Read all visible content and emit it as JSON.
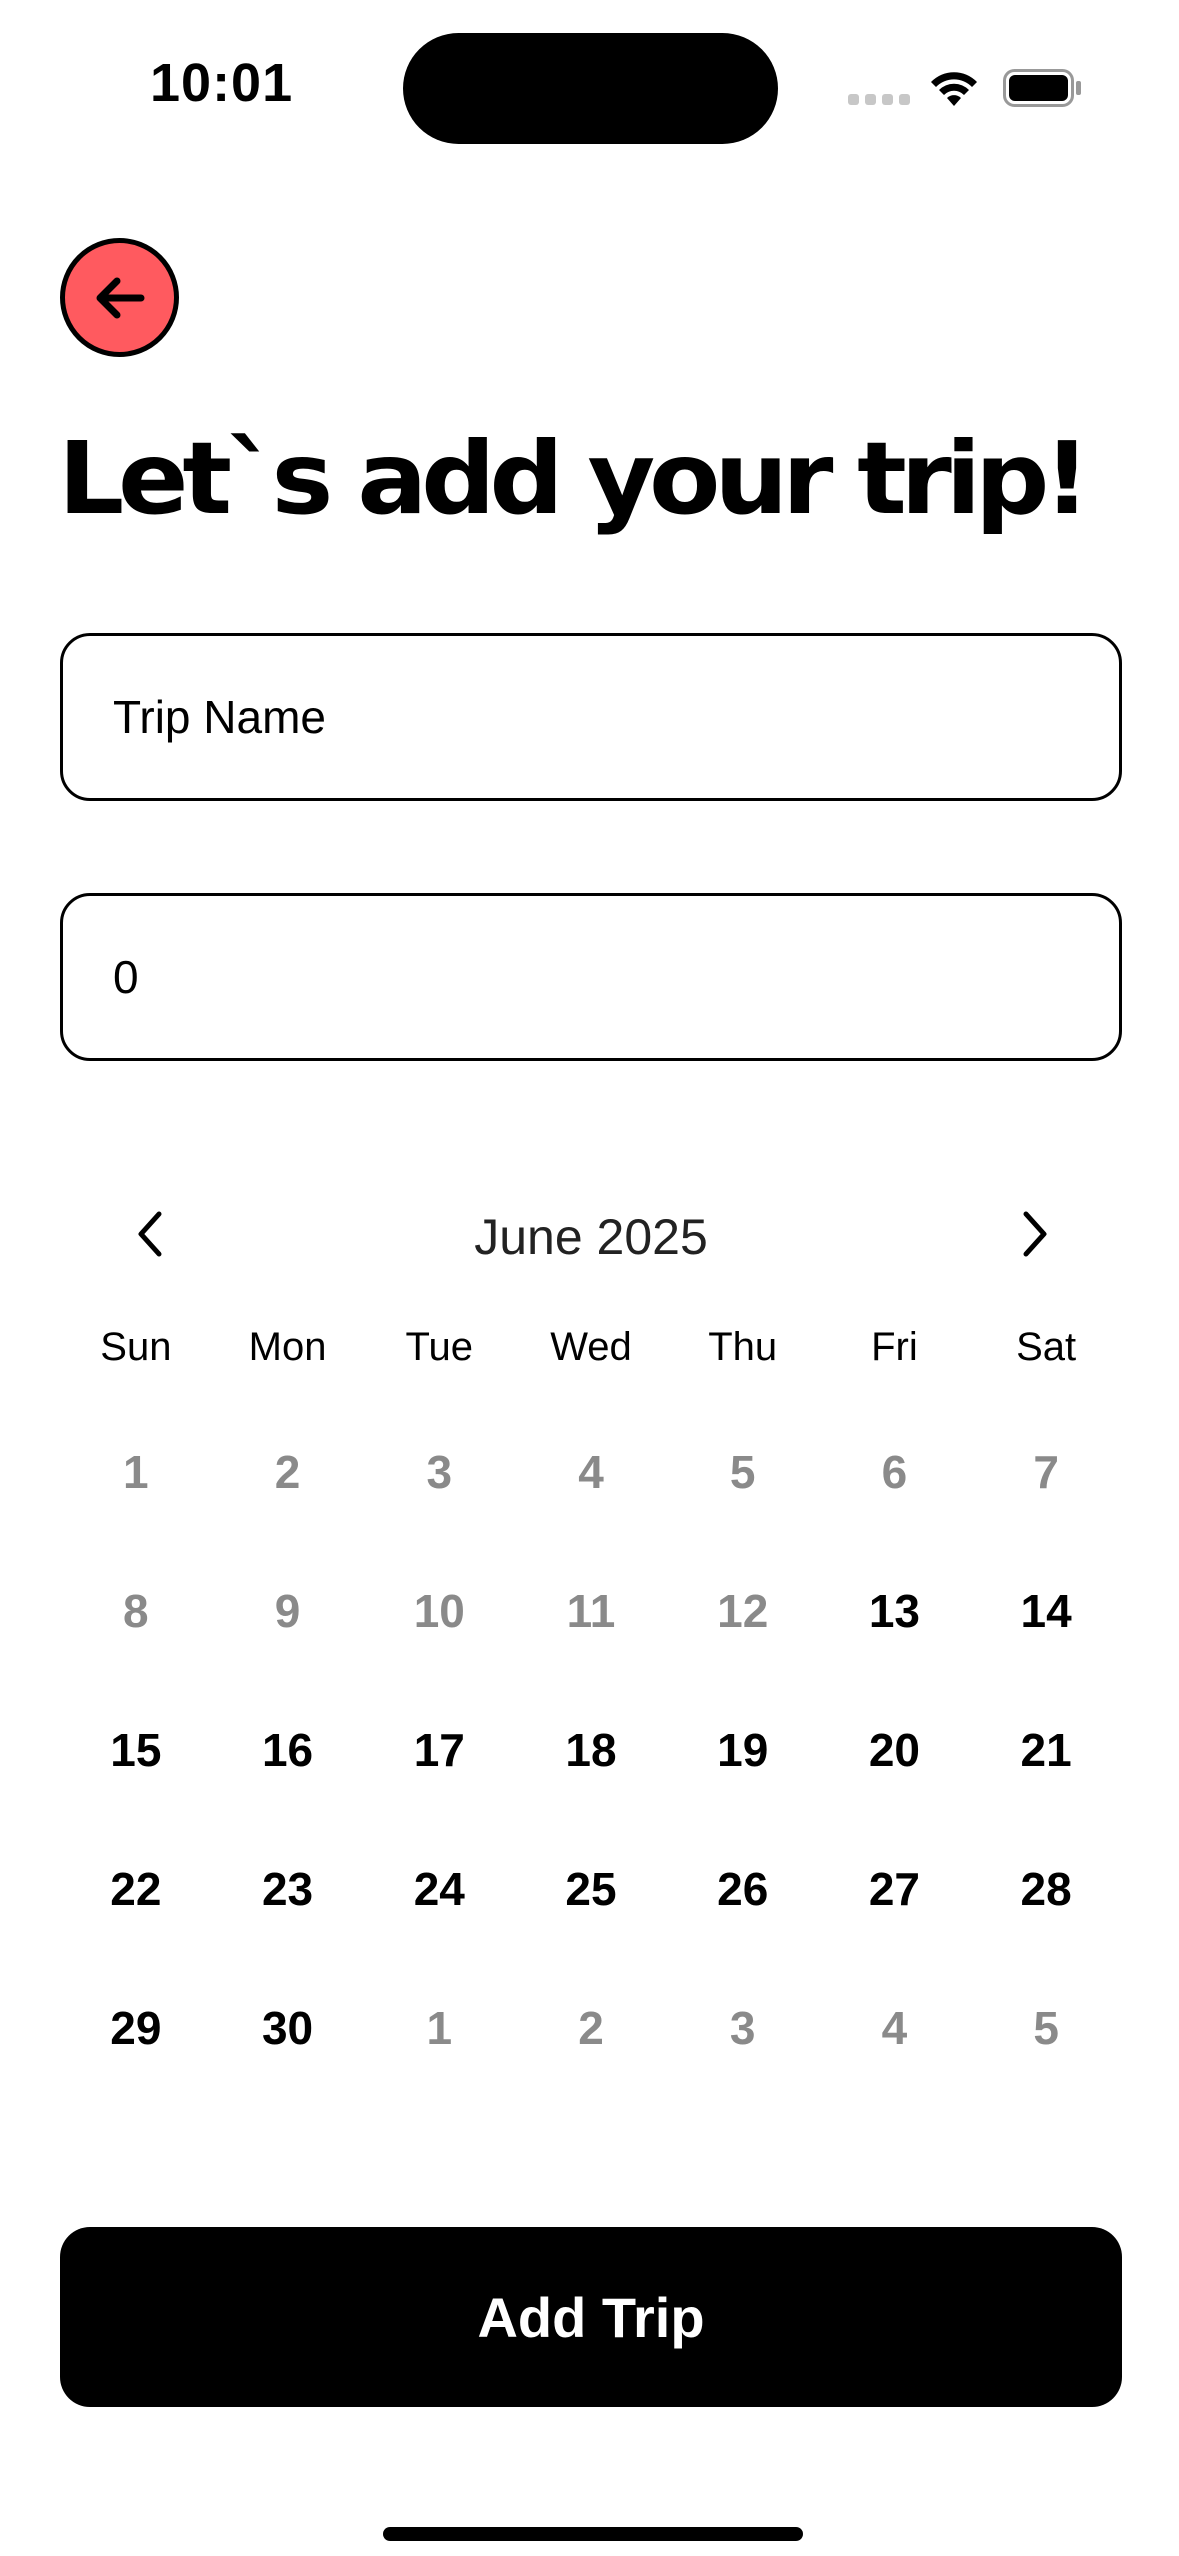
{
  "status_bar": {
    "time": "10:01"
  },
  "header": {
    "title": "Let`s add your trip!",
    "back_icon": "arrow-left-icon",
    "back_button_color": "#ff5a5f"
  },
  "form": {
    "trip_name_placeholder": "Trip Name",
    "amount_value": "0"
  },
  "calendar": {
    "month_label": "June 2025",
    "weekdays": [
      "Sun",
      "Mon",
      "Tue",
      "Wed",
      "Thu",
      "Fri",
      "Sat"
    ],
    "days": [
      {
        "label": "1",
        "state": "muted"
      },
      {
        "label": "2",
        "state": "muted"
      },
      {
        "label": "3",
        "state": "muted"
      },
      {
        "label": "4",
        "state": "muted"
      },
      {
        "label": "5",
        "state": "muted"
      },
      {
        "label": "6",
        "state": "muted"
      },
      {
        "label": "7",
        "state": "muted"
      },
      {
        "label": "8",
        "state": "muted"
      },
      {
        "label": "9",
        "state": "muted"
      },
      {
        "label": "10",
        "state": "muted"
      },
      {
        "label": "11",
        "state": "muted"
      },
      {
        "label": "12",
        "state": "muted"
      },
      {
        "label": "13",
        "state": "active"
      },
      {
        "label": "14",
        "state": "active"
      },
      {
        "label": "15",
        "state": "active"
      },
      {
        "label": "16",
        "state": "active"
      },
      {
        "label": "17",
        "state": "active"
      },
      {
        "label": "18",
        "state": "active"
      },
      {
        "label": "19",
        "state": "active"
      },
      {
        "label": "20",
        "state": "active"
      },
      {
        "label": "21",
        "state": "active"
      },
      {
        "label": "22",
        "state": "active"
      },
      {
        "label": "23",
        "state": "active"
      },
      {
        "label": "24",
        "state": "active"
      },
      {
        "label": "25",
        "state": "active"
      },
      {
        "label": "26",
        "state": "active"
      },
      {
        "label": "27",
        "state": "active"
      },
      {
        "label": "28",
        "state": "active"
      },
      {
        "label": "29",
        "state": "active"
      },
      {
        "label": "30",
        "state": "active"
      },
      {
        "label": "1",
        "state": "muted"
      },
      {
        "label": "2",
        "state": "muted"
      },
      {
        "label": "3",
        "state": "muted"
      },
      {
        "label": "4",
        "state": "muted"
      },
      {
        "label": "5",
        "state": "muted"
      }
    ]
  },
  "actions": {
    "add_trip_label": "Add Trip"
  }
}
